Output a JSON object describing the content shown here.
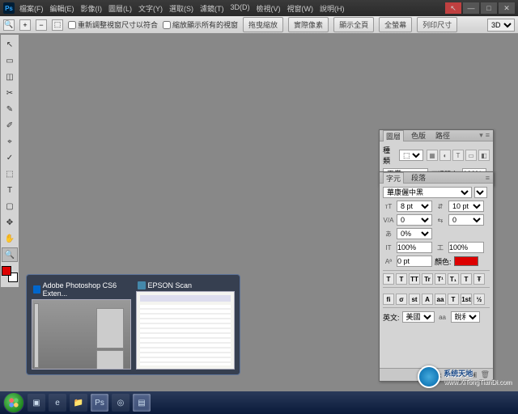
{
  "menu": [
    "檔案(F)",
    "編輯(E)",
    "影像(I)",
    "圖層(L)",
    "文字(Y)",
    "選取(S)",
    "濾鏡(T)",
    "3D(D)",
    "檢視(V)",
    "視窗(W)",
    "說明(H)"
  ],
  "winbtns": {
    "red": "↖",
    "min": "—",
    "max": "□",
    "close": "✕"
  },
  "optbar": {
    "checkbox1": "重新調整視窗尺寸以符合",
    "checkbox2": "縮放顯示所有的視窗",
    "btn1": "拖曳縮放",
    "btn2": "實際像素",
    "btn3": "顯示全頁",
    "btn4": "全螢幕",
    "btn5": "列印尺寸",
    "mode": "3D"
  },
  "tools": [
    "↖",
    "▭",
    "◫",
    "✂",
    "✎",
    "✐",
    "⌖",
    "✓",
    "⬚",
    "T",
    "▢",
    "✥",
    "✋",
    "🔍"
  ],
  "layers": {
    "tabs": [
      "圖層",
      "色版",
      "路徑"
    ],
    "kind": "種類",
    "blend": "正常",
    "opacity_label": "不透明度:",
    "opacity": "100%"
  },
  "char": {
    "tabs": [
      "字元",
      "段落"
    ],
    "font": "華康儷中黑",
    "size": "8 pt",
    "leading": "10 pt",
    "va": "0",
    "tracking": "0",
    "shift": "0%",
    "scale_v": "100%",
    "scale_h": "100%",
    "baseline": "0 pt",
    "color_label": "顏色:",
    "styles": [
      "T",
      "T",
      "TT",
      "Tr",
      "T¹",
      "T₁",
      "T",
      "Ŧ"
    ],
    "ot": [
      "fi",
      "σ",
      "st",
      "A",
      "aa",
      "T",
      "1st",
      "½"
    ],
    "lang_label": "英文: ",
    "lang": "美國",
    "aa_label": "aa",
    "aa": "銳利"
  },
  "alttab": {
    "items": [
      {
        "title": "Adobe Photoshop CS6 Exten..."
      },
      {
        "title": "EPSON Scan"
      }
    ]
  },
  "watermark": {
    "brand": "系统天地",
    "url": "www.XiTongTianDi.com"
  }
}
